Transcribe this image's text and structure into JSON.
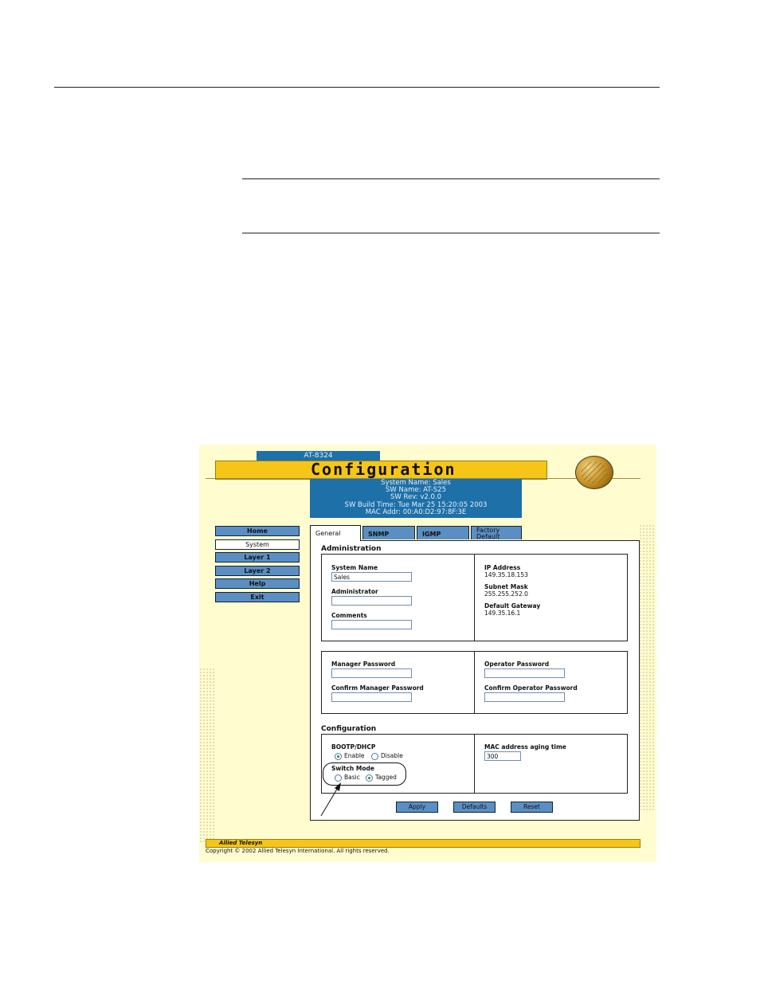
{
  "header": {
    "model_tab": "AT-8324",
    "title": "Configuration"
  },
  "system_info": {
    "lines": [
      "System Name: Sales",
      "SW Name: AT-S25",
      "SW Rev: v2.0.0",
      "SW Build Time: Tue Mar 25 15:20:05 2003",
      "MAC Addr: 00:A0:D2:97:8F:3E"
    ]
  },
  "nav": {
    "items": [
      {
        "label": "Home"
      },
      {
        "label": "System"
      },
      {
        "label": "Layer 1"
      },
      {
        "label": "Layer 2"
      },
      {
        "label": "Help"
      },
      {
        "label": "Exit"
      }
    ],
    "active": "System"
  },
  "tabs": [
    {
      "label": "General"
    },
    {
      "label": "SNMP"
    },
    {
      "label": "IGMP"
    },
    {
      "label": "Factory Default",
      "line1": "Factory",
      "line2": "Default"
    }
  ],
  "administration": {
    "title": "Administration",
    "system_name_label": "System Name",
    "system_name_value": "Sales",
    "administrator_label": "Administrator",
    "administrator_value": "",
    "comments_label": "Comments",
    "comments_value": "",
    "ip_address_label": "IP Address",
    "ip_address_value": "149.35.18.153",
    "subnet_mask_label": "Subnet Mask",
    "subnet_mask_value": "255.255.252.0",
    "default_gateway_label": "Default Gateway",
    "default_gateway_value": "149.35.16.1"
  },
  "passwords": {
    "manager_password_label": "Manager Password",
    "confirm_manager_password_label": "Confirm Manager Password",
    "operator_password_label": "Operator Password",
    "confirm_operator_password_label": "Confirm Operator Password"
  },
  "configuration": {
    "title": "Configuration",
    "bootp_label": "BOOTP/DHCP",
    "enable_label": "Enable",
    "disable_label": "Disable",
    "bootp_selected": "Enable",
    "switch_mode_label": "Switch Mode",
    "basic_label": "Basic",
    "tagged_label": "Tagged",
    "switch_mode_selected": "Tagged",
    "mac_aging_label": "MAC address aging time",
    "mac_aging_value": "300"
  },
  "buttons": {
    "apply": "Apply",
    "defaults": "Defaults",
    "reset": "Reset"
  },
  "footer": {
    "brand": "Allied Telesyn",
    "copyright": "Copyright © 2002 Allied Telesyn International. All rights reserved."
  },
  "colors": {
    "accent_yellow": "#f5c518",
    "header_blue": "#1d70a8",
    "button_blue": "#5b8fc4",
    "page_bg": "#fffdd0"
  }
}
